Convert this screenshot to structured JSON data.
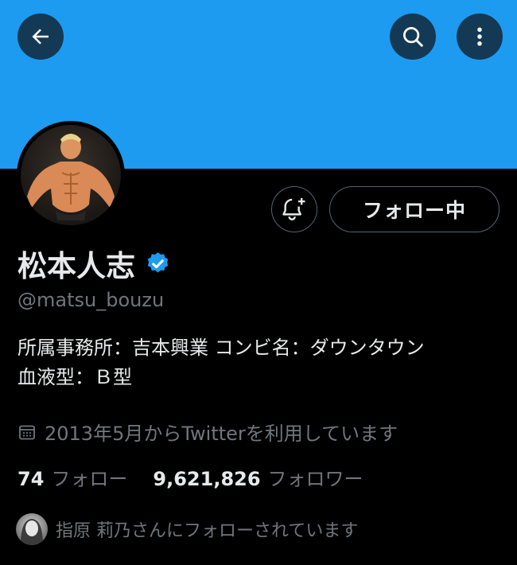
{
  "colors": {
    "banner": "#1D9BF0",
    "background": "#000000",
    "verified_badge": "#1D9BF0",
    "secondary_text": "#71767B"
  },
  "header": {
    "back_icon": "arrow-left-icon",
    "search_icon": "search-icon",
    "more_icon": "more-vertical-icon"
  },
  "profile": {
    "name": "松本人志",
    "handle": "@matsu_bouzu",
    "bio_line1": "所属事務所：吉本興業 コンビ名：ダウンタウン",
    "bio_line2": "血液型：Ｂ型",
    "joined": "2013年5月からTwitterを利用しています",
    "follow_button_label": "フォロー中",
    "notify_icon": "bell-plus-icon",
    "verified_icon": "verified-badge-icon",
    "calendar_icon": "calendar-icon"
  },
  "stats": {
    "following_count": "74",
    "following_label": "フォロー",
    "followers_count": "9,621,826",
    "followers_label": "フォロワー"
  },
  "followed_by": {
    "text": "指原 莉乃さんにフォローされています"
  }
}
